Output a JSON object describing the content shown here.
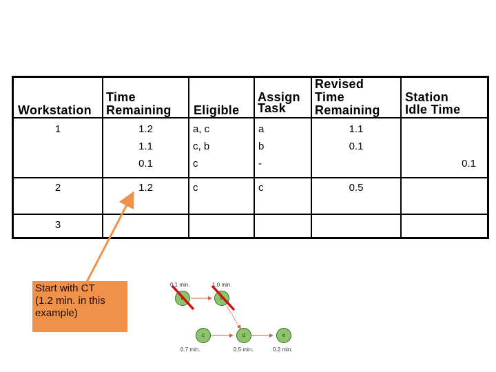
{
  "table": {
    "headers": {
      "workstation": "Workstation",
      "time_remaining_1": "Time",
      "time_remaining_2": "Remaining",
      "eligible": "Eligible",
      "assign_1": "Assign",
      "assign_2": "Task",
      "revised_1": "Revised",
      "revised_2": "Time",
      "revised_3": "Remaining",
      "idle_1": "Station",
      "idle_2": "Idle Time"
    },
    "rows": [
      {
        "workstation": "1",
        "time_remaining": [
          "1.2",
          "1.1",
          "0.1"
        ],
        "eligible": [
          "a, c",
          "c, b",
          "c"
        ],
        "assign": [
          "a",
          "b",
          "-"
        ],
        "revised": [
          "1.1",
          "0.1"
        ],
        "idle": "0.1"
      },
      {
        "workstation": "2",
        "time_remaining": [
          "1.2"
        ],
        "eligible": [
          "c"
        ],
        "assign": [
          "c"
        ],
        "revised": [
          "0.5"
        ],
        "idle": ""
      },
      {
        "workstation": "3",
        "time_remaining": [],
        "eligible": [],
        "assign": [],
        "revised": [],
        "idle": ""
      }
    ]
  },
  "callout": {
    "line1": "Start with CT",
    "line2": "(1.2 min. in this",
    "line3": "example)",
    "color": "#f0914a"
  },
  "diagram": {
    "nodes": [
      {
        "id": "a",
        "label": "a",
        "time": "0.1 min.",
        "crossed": true
      },
      {
        "id": "b",
        "label": "b",
        "time": "1.0 min.",
        "crossed": true
      },
      {
        "id": "c",
        "label": "c",
        "time": "0.7 min.",
        "crossed": false
      },
      {
        "id": "d",
        "label": "d",
        "time": "0.5 min.",
        "crossed": false
      },
      {
        "id": "e",
        "label": "e",
        "time": "0.2 min.",
        "crossed": false
      }
    ],
    "node_color": "#8cc46a",
    "edge_color": "#d0603a",
    "cross_color": "#cc1111"
  }
}
